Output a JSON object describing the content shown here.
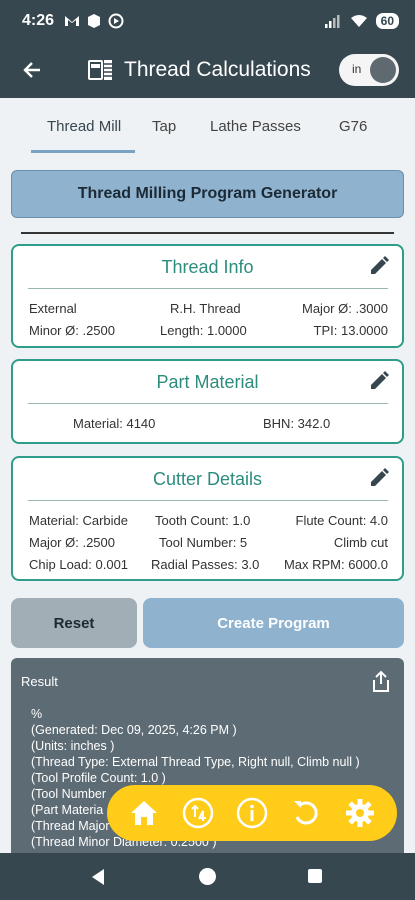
{
  "status_bar": {
    "time": "4:26",
    "battery": "60"
  },
  "app_bar": {
    "title": "Thread Calculations",
    "unit_toggle_label": "in"
  },
  "tabs": [
    {
      "label": "Thread Mill"
    },
    {
      "label": "Tap"
    },
    {
      "label": "Lathe Passes"
    },
    {
      "label": "G76"
    }
  ],
  "banner": {
    "label": "Thread Milling Program Generator"
  },
  "thread_info": {
    "title": "Thread Info",
    "type": "External",
    "hand": "R.H. Thread",
    "major": "Major Ø: .3000",
    "minor": "Minor Ø: .2500",
    "length": "Length: 1.0000",
    "tpi": "TPI: 13.0000"
  },
  "part_material": {
    "title": "Part Material",
    "material": "Material: 4140",
    "bhn": "BHN: 342.0"
  },
  "cutter_details": {
    "title": "Cutter Details",
    "material": "Material: Carbide",
    "tooth_count": "Tooth Count: 1.0",
    "flute_count": "Flute Count: 4.0",
    "major": "Major Ø: .2500",
    "tool_number": "Tool Number: 5",
    "cut_dir": "Climb cut",
    "chip_load": "Chip Load: 0.001",
    "radial_passes": "Radial Passes: 3.0",
    "max_rpm": "Max RPM: 6000.0"
  },
  "buttons": {
    "reset": "Reset",
    "create": "Create Program"
  },
  "result": {
    "title": "Result",
    "lines": [
      "%",
      "(Generated: Dec 09, 2025, 4:26 PM )",
      "(Units: inches )",
      "(Thread Type: External Thread Type, Right null, Climb null )",
      "(Tool Profile Count: 1.0 )",
      "(Tool Number",
      "(Part Materia",
      "(Thread Major",
      "(Thread Minor Diameter: 0.2500 )"
    ]
  },
  "fab_icons": [
    "home-icon",
    "calculator-badge-icon",
    "info-icon",
    "undo-icon",
    "settings-icon"
  ],
  "colors": {
    "dark": "#37474f",
    "accent_teal": "#2f9c8c",
    "banner_blue": "#8fb2cf",
    "fab_yellow": "#ffcc1a"
  }
}
